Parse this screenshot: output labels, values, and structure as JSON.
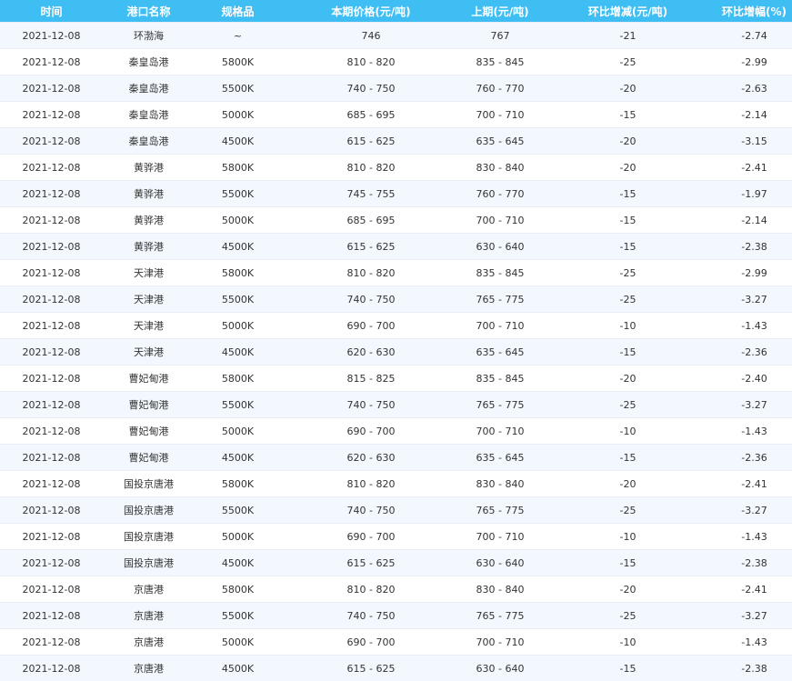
{
  "colors": {
    "header_bg": "#3fbef3",
    "header_text": "#ffffff",
    "row_alt_bg": "#f2f8fe",
    "text": "#333333"
  },
  "table": {
    "headers": [
      "时间",
      "港口名称",
      "规格品",
      "本期价格(元/吨)",
      "上期(元/吨)",
      "环比增减(元/吨)",
      "环比增幅(%)"
    ],
    "rows": [
      [
        "2021-12-08",
        "环渤海",
        "~",
        "746",
        "767",
        "-21",
        "-2.74"
      ],
      [
        "2021-12-08",
        "秦皇岛港",
        "5800K",
        "810 - 820",
        "835 - 845",
        "-25",
        "-2.99"
      ],
      [
        "2021-12-08",
        "秦皇岛港",
        "5500K",
        "740 - 750",
        "760 - 770",
        "-20",
        "-2.63"
      ],
      [
        "2021-12-08",
        "秦皇岛港",
        "5000K",
        "685 - 695",
        "700 - 710",
        "-15",
        "-2.14"
      ],
      [
        "2021-12-08",
        "秦皇岛港",
        "4500K",
        "615 - 625",
        "635 - 645",
        "-20",
        "-3.15"
      ],
      [
        "2021-12-08",
        "黄骅港",
        "5800K",
        "810 - 820",
        "830 - 840",
        "-20",
        "-2.41"
      ],
      [
        "2021-12-08",
        "黄骅港",
        "5500K",
        "745 - 755",
        "760 - 770",
        "-15",
        "-1.97"
      ],
      [
        "2021-12-08",
        "黄骅港",
        "5000K",
        "685 - 695",
        "700 - 710",
        "-15",
        "-2.14"
      ],
      [
        "2021-12-08",
        "黄骅港",
        "4500K",
        "615 - 625",
        "630 - 640",
        "-15",
        "-2.38"
      ],
      [
        "2021-12-08",
        "天津港",
        "5800K",
        "810 - 820",
        "835 - 845",
        "-25",
        "-2.99"
      ],
      [
        "2021-12-08",
        "天津港",
        "5500K",
        "740 - 750",
        "765 - 775",
        "-25",
        "-3.27"
      ],
      [
        "2021-12-08",
        "天津港",
        "5000K",
        "690 - 700",
        "700 - 710",
        "-10",
        "-1.43"
      ],
      [
        "2021-12-08",
        "天津港",
        "4500K",
        "620 - 630",
        "635 - 645",
        "-15",
        "-2.36"
      ],
      [
        "2021-12-08",
        "曹妃甸港",
        "5800K",
        "815 - 825",
        "835 - 845",
        "-20",
        "-2.40"
      ],
      [
        "2021-12-08",
        "曹妃甸港",
        "5500K",
        "740 - 750",
        "765 - 775",
        "-25",
        "-3.27"
      ],
      [
        "2021-12-08",
        "曹妃甸港",
        "5000K",
        "690 - 700",
        "700 - 710",
        "-10",
        "-1.43"
      ],
      [
        "2021-12-08",
        "曹妃甸港",
        "4500K",
        "620 - 630",
        "635 - 645",
        "-15",
        "-2.36"
      ],
      [
        "2021-12-08",
        "国投京唐港",
        "5800K",
        "810 - 820",
        "830 - 840",
        "-20",
        "-2.41"
      ],
      [
        "2021-12-08",
        "国投京唐港",
        "5500K",
        "740 - 750",
        "765 - 775",
        "-25",
        "-3.27"
      ],
      [
        "2021-12-08",
        "国投京唐港",
        "5000K",
        "690 - 700",
        "700 - 710",
        "-10",
        "-1.43"
      ],
      [
        "2021-12-08",
        "国投京唐港",
        "4500K",
        "615 - 625",
        "630 - 640",
        "-15",
        "-2.38"
      ],
      [
        "2021-12-08",
        "京唐港",
        "5800K",
        "810 - 820",
        "830 - 840",
        "-20",
        "-2.41"
      ],
      [
        "2021-12-08",
        "京唐港",
        "5500K",
        "740 - 750",
        "765 - 775",
        "-25",
        "-3.27"
      ],
      [
        "2021-12-08",
        "京唐港",
        "5000K",
        "690 - 700",
        "700 - 710",
        "-10",
        "-1.43"
      ],
      [
        "2021-12-08",
        "京唐港",
        "4500K",
        "615 - 625",
        "630 - 640",
        "-15",
        "-2.38"
      ]
    ]
  }
}
